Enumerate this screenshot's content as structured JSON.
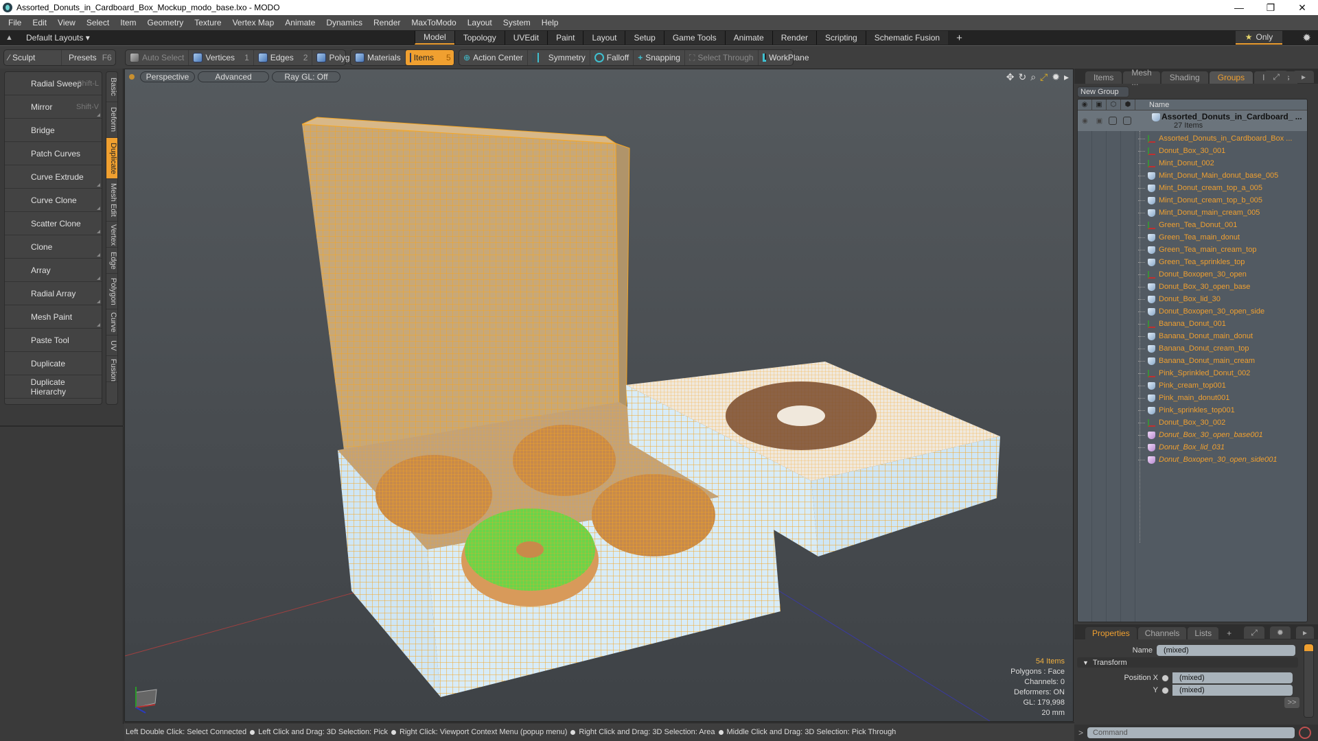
{
  "window": {
    "title": "Assorted_Donuts_in_Cardboard_Box_Mockup_modo_base.lxo - MODO",
    "controls": {
      "minimize": "—",
      "restore": "❐",
      "close": "✕"
    }
  },
  "menu": [
    "File",
    "Edit",
    "View",
    "Select",
    "Item",
    "Geometry",
    "Texture",
    "Vertex Map",
    "Animate",
    "Dynamics",
    "Render",
    "MaxToModo",
    "Layout",
    "System",
    "Help"
  ],
  "layoutbar": {
    "layout_name": "Default Layouts ▾",
    "tabs": [
      {
        "label": "Model",
        "active": true
      },
      {
        "label": "Topology"
      },
      {
        "label": "UVEdit"
      },
      {
        "label": "Paint"
      },
      {
        "label": "Layout"
      },
      {
        "label": "Setup"
      },
      {
        "label": "Game Tools"
      },
      {
        "label": "Animate"
      },
      {
        "label": "Render"
      },
      {
        "label": "Scripting"
      },
      {
        "label": "Schematic Fusion"
      }
    ],
    "add_tab": "+",
    "only_label": "Only"
  },
  "toolbar": {
    "sculpt": "Sculpt",
    "presets": "Presets",
    "presets_key": "F6",
    "auto_select": "Auto Select",
    "vertices": "Vertices",
    "vertices_key": "1",
    "edges": "Edges",
    "edges_key": "2",
    "polygons": "Polygons",
    "materials": "Materials",
    "items": "Items",
    "items_key": "5",
    "action_center": "Action Center",
    "symmetry": "Symmetry",
    "falloff": "Falloff",
    "snapping": "Snapping",
    "select_through": "Select Through",
    "workplane": "WorkPlane"
  },
  "tools": [
    {
      "label": "Radial Sweep",
      "key": "Shift-L",
      "icon": "radial-sweep-icon",
      "color": "#2fb070"
    },
    {
      "label": "Mirror",
      "key": "Shift-V",
      "icon": "mirror-icon",
      "color": "#2fb070"
    },
    {
      "label": "Bridge",
      "key": "",
      "icon": "bridge-icon",
      "color": "#40b060"
    },
    {
      "label": "Patch Curves",
      "key": "",
      "icon": "patch-curves-icon",
      "color": "#7a9a6a"
    },
    {
      "label": "Curve Extrude",
      "key": "",
      "icon": "curve-extrude-icon",
      "color": "#2fb070"
    },
    {
      "label": "Curve Clone",
      "key": "",
      "icon": "curve-clone-icon",
      "color": "#5a5ac8"
    },
    {
      "label": "Scatter Clone",
      "key": "",
      "icon": "scatter-clone-icon",
      "color": "#5a5ac8"
    },
    {
      "label": "Clone",
      "key": "",
      "icon": "clone-icon",
      "color": "#6a6ad0"
    },
    {
      "label": "Array",
      "key": "",
      "icon": "array-icon",
      "color": "#5050c0"
    },
    {
      "label": "Radial Array",
      "key": "",
      "icon": "radial-array-icon",
      "color": "#5a5ac8"
    },
    {
      "label": "Mesh Paint",
      "key": "",
      "icon": "mesh-paint-icon",
      "color": "#40b070"
    },
    {
      "label": "Paste Tool",
      "key": "",
      "icon": "paste-tool-icon",
      "color": "#30b060"
    },
    {
      "label": "Duplicate",
      "key": "",
      "icon": "duplicate-icon",
      "color": "#6a6ad0"
    },
    {
      "label": "Duplicate Hierarchy",
      "key": "",
      "icon": "duplicate-hierarchy-icon",
      "color": "#5a5ac8"
    }
  ],
  "vertical_tabs": [
    {
      "label": "Basic"
    },
    {
      "label": "Deform"
    },
    {
      "label": "Duplicate",
      "active": true
    },
    {
      "label": "Mesh Edit"
    },
    {
      "label": "Vertex"
    },
    {
      "label": "Edge"
    },
    {
      "label": "Polygon"
    },
    {
      "label": "Curve"
    },
    {
      "label": "UV"
    },
    {
      "label": "Fusion"
    }
  ],
  "viewport": {
    "view_mode": "Perspective",
    "shading": "Advanced",
    "raygl": "Ray GL: Off",
    "stats": {
      "items": "54 Items",
      "polygons": "Polygons : Face",
      "channels": "Channels: 0",
      "deformers": "Deformers: ON",
      "gl": "GL: 179,998",
      "scale": "20 mm"
    }
  },
  "scene_panel": {
    "tabs": [
      {
        "label": "Items"
      },
      {
        "label": "Mesh ..."
      },
      {
        "label": "Shading"
      },
      {
        "label": "Groups",
        "active": true
      },
      {
        "label": "Images"
      }
    ],
    "new_group": "New Group",
    "column_name": "Name",
    "group": {
      "name": "Assorted_Donuts_in_Cardboard_ ...",
      "count": "27 Items"
    },
    "items": [
      {
        "name": "Assorted_Donuts_in_Cardboard_Box ...",
        "type": "locator"
      },
      {
        "name": "Donut_Box_30_001",
        "type": "locator"
      },
      {
        "name": "Mint_Donut_002",
        "type": "locator"
      },
      {
        "name": "Mint_Donut_Main_donut_base_005",
        "type": "mesh"
      },
      {
        "name": "Mint_Donut_cream_top_a_005",
        "type": "mesh"
      },
      {
        "name": "Mint_Donut_cream_top_b_005",
        "type": "mesh"
      },
      {
        "name": "Mint_Donut_main_cream_005",
        "type": "mesh"
      },
      {
        "name": "Green_Tea_Donut_001",
        "type": "locator"
      },
      {
        "name": "Green_Tea_main_donut",
        "type": "mesh"
      },
      {
        "name": "Green_Tea_main_cream_top",
        "type": "mesh"
      },
      {
        "name": "Green_Tea_sprinkles_top",
        "type": "mesh"
      },
      {
        "name": "Donut_Boxopen_30_open",
        "type": "locator"
      },
      {
        "name": "Donut_Box_30_open_base",
        "type": "mesh"
      },
      {
        "name": "Donut_Box_lid_30",
        "type": "mesh"
      },
      {
        "name": "Donut_Boxopen_30_open_side",
        "type": "mesh"
      },
      {
        "name": "Banana_Donut_001",
        "type": "locator"
      },
      {
        "name": "Banana_Donut_main_donut",
        "type": "mesh"
      },
      {
        "name": "Banana_Donut_cream_top",
        "type": "mesh"
      },
      {
        "name": "Banana_Donut_main_cream",
        "type": "mesh"
      },
      {
        "name": "Pink_Sprinkled_Donut_002",
        "type": "locator"
      },
      {
        "name": "Pink_cream_top001",
        "type": "mesh"
      },
      {
        "name": "Pink_main_donut001",
        "type": "mesh"
      },
      {
        "name": "Pink_sprinkles_top001",
        "type": "mesh"
      },
      {
        "name": "Donut_Box_30_002",
        "type": "locator"
      },
      {
        "name": "Donut_Box_30_open_base001",
        "type": "instance"
      },
      {
        "name": "Donut_Box_lid_031",
        "type": "instance"
      },
      {
        "name": "Donut_Boxopen_30_open_side001",
        "type": "instance"
      }
    ]
  },
  "properties": {
    "tabs": [
      {
        "label": "Properties",
        "active": true
      },
      {
        "label": "Channels"
      },
      {
        "label": "Lists"
      }
    ],
    "name_label": "Name",
    "name_value": "(mixed)",
    "transform_label": "Transform",
    "position_x_label": "Position X",
    "position_x_value": "(mixed)",
    "position_y_label": "Y",
    "position_y_value": "(mixed)",
    "more": ">>",
    "command_placeholder": "Command"
  },
  "statusbar": [
    "Left Double Click: Select Connected",
    "Left Click and Drag: 3D Selection: Pick",
    "Right Click: Viewport Context Menu (popup menu)",
    "Right Click and Drag: 3D Selection: Area",
    "Middle Click and Drag: 3D Selection: Pick Through"
  ],
  "colors": {
    "accent": "#f0a030",
    "item_text": "#f0a030",
    "wire": "#f5a623",
    "mint": "#6bd44a"
  }
}
